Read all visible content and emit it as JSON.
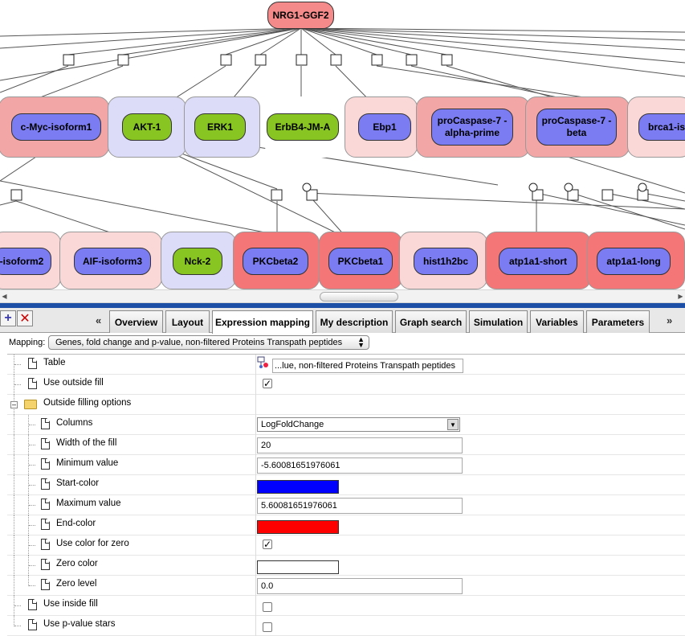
{
  "graph": {
    "root": "NRG1-GGF2",
    "row1": [
      {
        "label": "c-Myc-isoform1",
        "kind": "blue",
        "halo": "#f3a6a6"
      },
      {
        "label": "AKT-1",
        "kind": "green",
        "halo": "#dcdcf8"
      },
      {
        "label": "ERK1",
        "kind": "green",
        "halo": "#dcdcf8"
      },
      {
        "label": "ErbB4-JM-A",
        "kind": "green",
        "halo": "#ffffff"
      },
      {
        "label": "Ebp1",
        "kind": "blue",
        "halo": "#fbd8d8"
      },
      {
        "label": "proCaspase-7 -alpha-prime",
        "kind": "blue",
        "halo": "#f3a6a6"
      },
      {
        "label": "proCaspase-7 -beta",
        "kind": "blue",
        "halo": "#f3a6a6"
      },
      {
        "label": "brca1-is",
        "kind": "blue",
        "halo": "#fbd8d8"
      }
    ],
    "row2": [
      {
        "label": "-isoform2",
        "kind": "blue",
        "halo": "#fbd8d8"
      },
      {
        "label": "AIF-isoform3",
        "kind": "blue",
        "halo": "#fbd8d8"
      },
      {
        "label": "Nck-2",
        "kind": "green",
        "halo": "#dcdcf8"
      },
      {
        "label": "PKCbeta2",
        "kind": "blue",
        "halo": "#f47676"
      },
      {
        "label": "PKCbeta1",
        "kind": "blue",
        "halo": "#f47676"
      },
      {
        "label": "hist1h2bc",
        "kind": "blue",
        "halo": "#fbd8d8"
      },
      {
        "label": "atp1a1-short",
        "kind": "blue",
        "halo": "#f47676"
      },
      {
        "label": "atp1a1-long",
        "kind": "blue",
        "halo": "#f47676"
      }
    ]
  },
  "tabs": {
    "prev": "«",
    "next": "»",
    "items": [
      {
        "label": "Overview"
      },
      {
        "label": "Layout"
      },
      {
        "label": "Expression mapping",
        "active": true
      },
      {
        "label": "My description"
      },
      {
        "label": "Graph search"
      },
      {
        "label": "Simulation"
      },
      {
        "label": "Variables"
      },
      {
        "label": "Parameters"
      }
    ]
  },
  "toolbar": {
    "add_icon": "plus-icon",
    "remove_icon": "remove-x-icon"
  },
  "mapping": {
    "label": "Mapping:",
    "value": "Genes, fold change and p-value, non-filtered Proteins Transpath peptides"
  },
  "properties": {
    "table_label": "Table",
    "table_value": "...lue, non-filtered Proteins Transpath peptides",
    "use_outside_fill_label": "Use outside fill",
    "outside_filling_label": "Outside filling options",
    "columns_label": "Columns",
    "columns_value": "LogFoldChange",
    "width_label": "Width of the fill",
    "width_value": "20",
    "min_label": "Minimum value",
    "min_value": "-5.60081651976061",
    "start_color_label": "Start-color",
    "start_color": "#0000ff",
    "max_label": "Maximum value",
    "max_value": "5.60081651976061",
    "end_color_label": "End-color",
    "end_color": "#ff0000",
    "use_zero_label": "Use color for zero",
    "zero_color_label": "Zero color",
    "zero_color": "#ffffff",
    "zero_level_label": "Zero level",
    "zero_level_value": "0.0",
    "use_inside_fill_label": "Use inside fill",
    "use_pvalue_label": "Use p-value stars",
    "checked_mark": "✓"
  }
}
